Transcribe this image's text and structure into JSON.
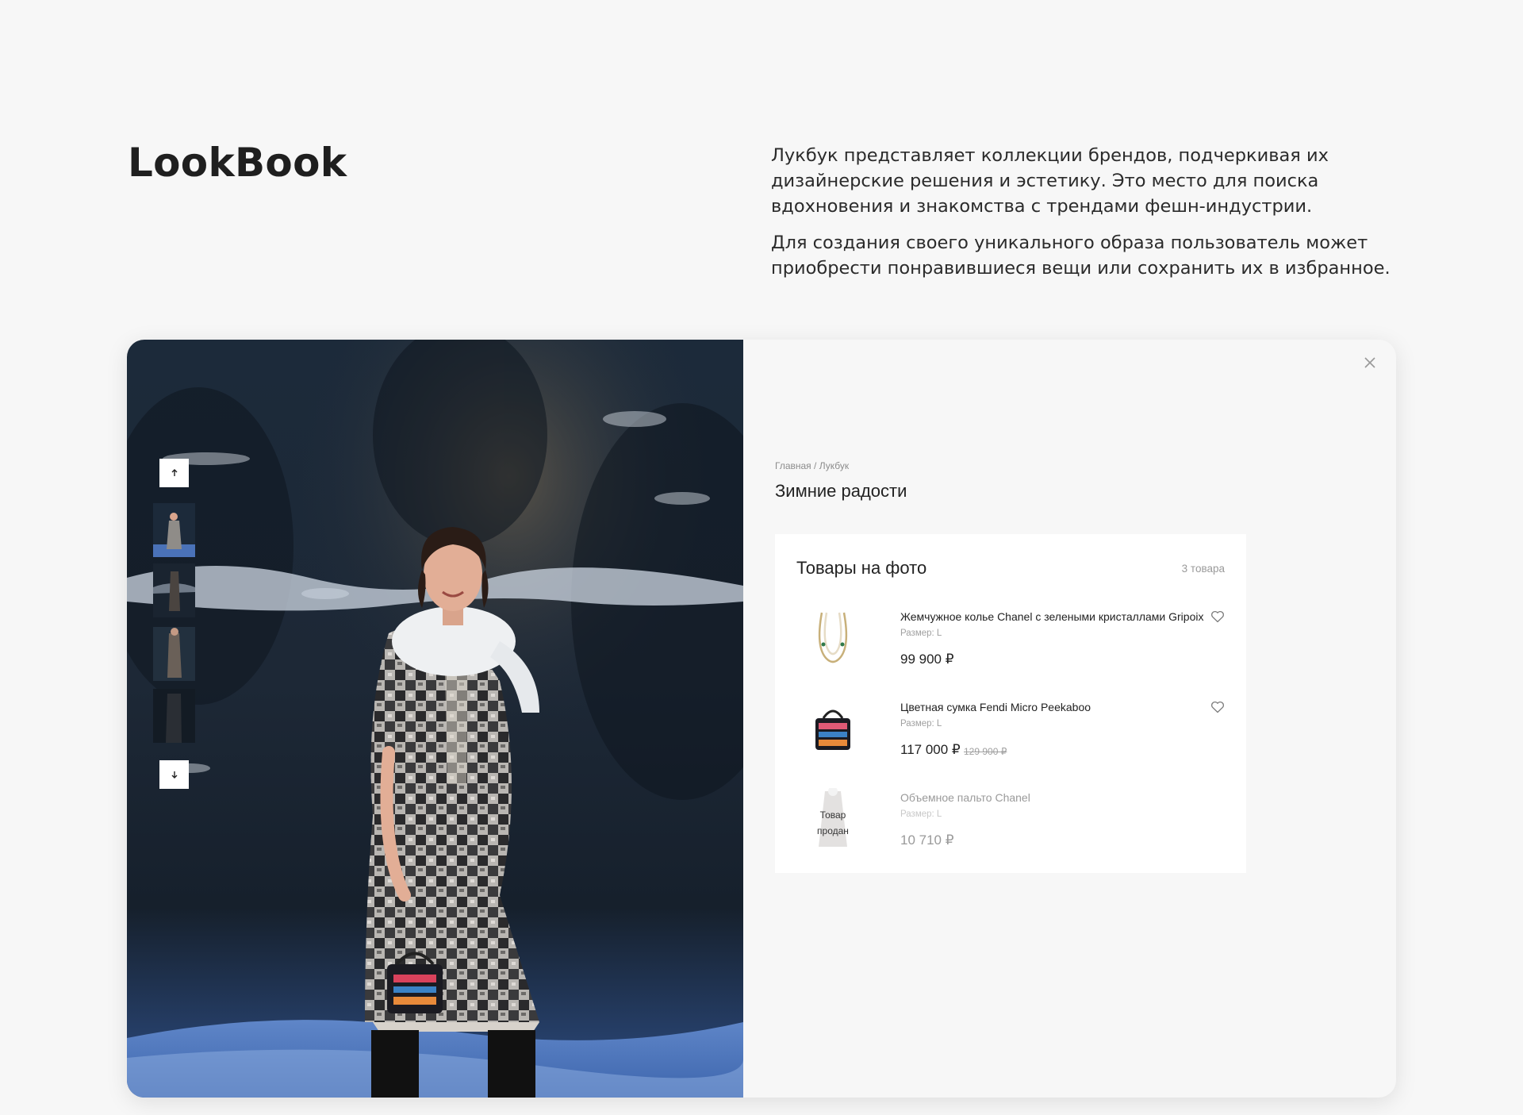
{
  "page": {
    "title": "LookBook",
    "intro": [
      "Лукбук представляет коллекции брендов, подчеркивая их дизайнерские решения и эстетику. Это место для поиска вдохновения и знакомства с трендами фешн-индустрии.",
      "Для создания своего уникального образа пользователь может приобрести понравившиеся вещи или сохранить их в избранное."
    ]
  },
  "viewer": {
    "close_icon": "close-icon",
    "nav": {
      "up_icon": "arrow-up-icon",
      "down_icon": "arrow-down-icon"
    },
    "thumbnails_count": 4
  },
  "details": {
    "breadcrumb": {
      "home": "Главная",
      "separator": " / ",
      "current": "Лукбук"
    },
    "title": "Зимние радости",
    "products": {
      "title": "Товары на фото",
      "count": "3 товара",
      "items": [
        {
          "name": "Жемчужное колье Chanel с зелеными кристаллами Gripoix",
          "size": "Размер: L",
          "price": "99 900 ₽",
          "old_price": "",
          "sold": false,
          "sold_label": ""
        },
        {
          "name": "Цветная сумка Fendi Micro Peekaboo",
          "size": "Размер: L",
          "price": "117 000 ₽",
          "old_price": "129 900 ₽",
          "sold": false,
          "sold_label": ""
        },
        {
          "name": "Объемное пальто Chanel",
          "size": "Размер: L",
          "price": "10 710 ₽",
          "old_price": "",
          "sold": true,
          "sold_label": "Товар продан"
        }
      ]
    }
  },
  "colors": {
    "background": "#f7f7f7",
    "card": "#ffffff",
    "muted": "#9a9a9a",
    "text": "#222222"
  }
}
